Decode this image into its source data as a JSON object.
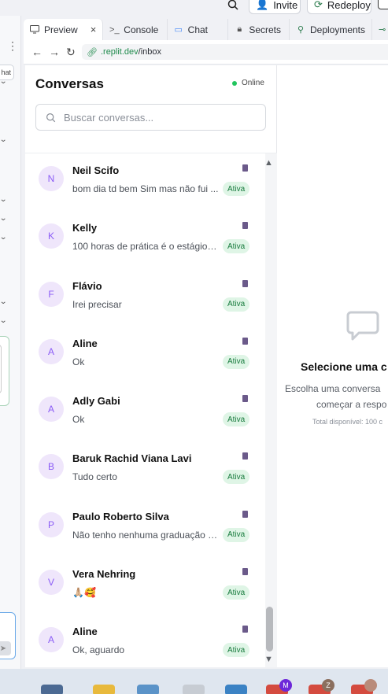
{
  "topbar": {
    "invite_label": "Invite",
    "redeploy_label": "Redeploy"
  },
  "leftstrip": {
    "button_label": "hat"
  },
  "tabs": [
    {
      "label": "Preview",
      "icon": "monitor-icon"
    },
    {
      "label": "Console",
      "icon": "terminal-icon"
    },
    {
      "label": "Chat",
      "icon": "chat-icon"
    },
    {
      "label": "Secrets",
      "icon": "lock-icon"
    },
    {
      "label": "Deployments",
      "icon": "deploy-icon"
    }
  ],
  "address": {
    "host": ".replit.dev",
    "path": "/inbox"
  },
  "app": {
    "title": "Conversas",
    "status": "Online",
    "search_placeholder": "Buscar conversas...",
    "conversations": [
      {
        "initial": "N",
        "name": "Neil Scifo",
        "message": "bom dia td bem Sim mas não fui ...",
        "badge": "Ativa"
      },
      {
        "initial": "K",
        "name": "Kelly",
        "message": "100 horas de prática é o estágio p...",
        "badge": "Ativa"
      },
      {
        "initial": "F",
        "name": "Flávio",
        "message": "Irei precisar",
        "badge": "Ativa"
      },
      {
        "initial": "A",
        "name": "Aline",
        "message": "Ok",
        "badge": "Ativa"
      },
      {
        "initial": "A",
        "name": "Adly Gabi",
        "message": "Ok",
        "badge": "Ativa"
      },
      {
        "initial": "B",
        "name": "Baruk Rachid Viana Lavi",
        "message": "Tudo certo",
        "badge": "Ativa"
      },
      {
        "initial": "P",
        "name": "Paulo Roberto Silva",
        "message": "Não tenho nenhuma graduação e...",
        "badge": "Ativa"
      },
      {
        "initial": "V",
        "name": "Vera Nehring",
        "message": "🙏🏼🥰",
        "badge": "Ativa"
      },
      {
        "initial": "A",
        "name": "Aline",
        "message": "Ok, aguardo",
        "badge": "Ativa"
      }
    ]
  },
  "right": {
    "title": "Selecione uma c",
    "desc_line1": "Escolha uma conversa",
    "desc_line2": "começar a respo",
    "total": "Total disponível: 100 c"
  },
  "taskbar": {
    "badge_m": "M",
    "badge_z": "Z"
  },
  "colors": {
    "online": "#22c55e",
    "badge_bg": "#dff5e6",
    "avatar_bg": "#efe6fb",
    "avatar_text": "#8b5cf6"
  }
}
